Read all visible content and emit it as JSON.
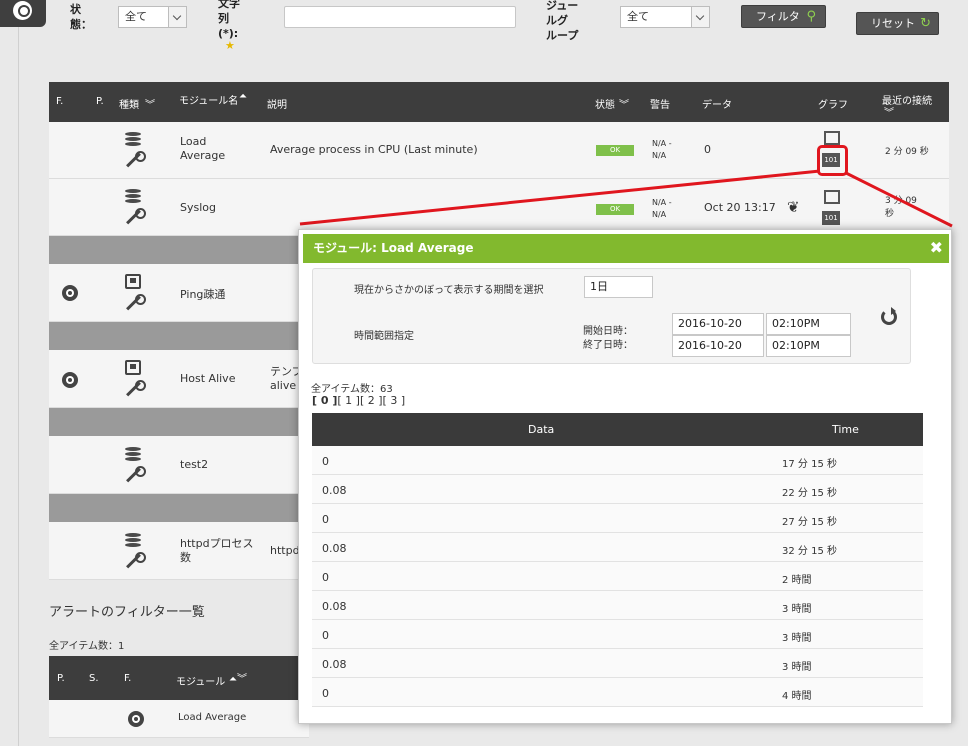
{
  "filter": {
    "status_label": "状\n態：",
    "status_value": "全て",
    "text_label": "文字\n列\n(*):",
    "group_label": "ジュー\nルグ\nループ",
    "group_value": "全て",
    "filter_button": "フィルタ",
    "reset_button": "リセット"
  },
  "table": {
    "headers": {
      "f": "F.",
      "p": "P.",
      "type": "種類",
      "module_name": "モジュール名",
      "description": "説明",
      "status": "状態",
      "warn": "警告",
      "data": "データ",
      "graph": "グラフ",
      "last_contact": "最近の接続"
    },
    "rows": [
      {
        "name": "Load\nAverage",
        "description": "Average process in CPU (Last minute)",
        "status": "OK",
        "warn": "N/A -\nN/A",
        "data": "0",
        "last": "2 分 09 秒",
        "graph_badge": "101"
      },
      {
        "name": "Syslog",
        "description": "",
        "status": "OK",
        "warn": "N/A -\nN/A",
        "data": "Oct 20 13:17",
        "last": "3 分 09\n秒",
        "graph_badge": "101"
      },
      {
        "name": "Ping疎通",
        "description": ""
      },
      {
        "name": "Host Alive",
        "description": "テンプ\nalive"
      },
      {
        "name": "test2",
        "description": ""
      },
      {
        "name": "httpdプロセス\n数",
        "description": "httpd"
      }
    ]
  },
  "alerts": {
    "title": "アラートのフィルター一覧",
    "count": "全アイテム数：1",
    "headers": {
      "p": "P.",
      "s": "S.",
      "f": "F.",
      "module": "モジュール"
    },
    "row_module": "Load Average"
  },
  "modal": {
    "title": "モジュール: Load Average",
    "period_label": "現在からさかのぼって表示する期間を選択",
    "period_value": "1日",
    "range_label": "時間範囲指定",
    "start_label": "開始日時：",
    "end_label": "終了日時：",
    "start_date": "2016-10-20",
    "start_time": "02:10PM",
    "end_date": "2016-10-20",
    "end_time": "02:10PM",
    "total_items": "全アイテム数：63",
    "pages": [
      "[ 0 ]",
      "[ 1 ]",
      "[ 2 ]",
      "[ 3 ]"
    ],
    "col_data": "Data",
    "col_time": "Time",
    "rows": [
      {
        "data": "0",
        "time": "17 分 15 秒"
      },
      {
        "data": "0.08",
        "time": "22 分 15 秒"
      },
      {
        "data": "0",
        "time": "27 分 15 秒"
      },
      {
        "data": "0.08",
        "time": "32 分 15 秒"
      },
      {
        "data": "0",
        "time": "2 時間"
      },
      {
        "data": "0.08",
        "time": "3 時間"
      },
      {
        "data": "0",
        "time": "3 時間"
      },
      {
        "data": "0.08",
        "time": "3 時間"
      },
      {
        "data": "0",
        "time": "4 時間"
      }
    ]
  },
  "colors": {
    "accent": "#82b92e",
    "ok": "#7fc04a",
    "callout": "#e0161e",
    "header": "#3d3d3d"
  }
}
